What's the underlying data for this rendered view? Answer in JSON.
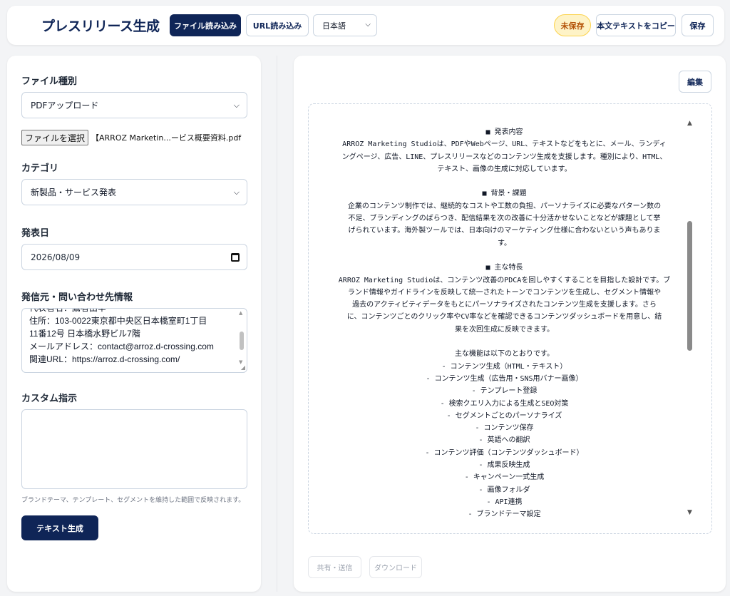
{
  "header": {
    "title": "プレスリリース生成",
    "file_import": "ファイル読み込み",
    "url_import": "URL読み込み",
    "language": "日本語",
    "unsaved": "未保存",
    "copy_text": "本文テキストをコピー",
    "save": "保存"
  },
  "form": {
    "file_type_label": "ファイル種別",
    "file_type_value": "PDFアップロード",
    "choose_file": "ファイルを選択",
    "file_name": "【ARROZ Marketin...ービス概要資料.pdf",
    "category_label": "カテゴリ",
    "category_value": "新製品・サービス発表",
    "date_label": "発表日",
    "date_value": "2026/08/09",
    "contact_label": "発信元・問い合わせ先情報",
    "contact_lines": [
      "代表者名：鷹者由幸",
      "住所：103-0022東京都中央区日本橋室町1丁目",
      "11番12号 日本橋水野ビル7階",
      "メールアドレス：contact@arroz.d-crossing.com",
      "関連URL：https://arroz.d-crossing.com/"
    ],
    "custom_label": "カスタム指示",
    "custom_value": "",
    "hint": "ブランドテーマ、テンプレート、セグメントを維持した範囲で反映されます。",
    "generate": "テキスト生成"
  },
  "preview": {
    "edit": "編集",
    "lines": [
      "■ 発表内容",
      "ARROZ Marketing Studioは、PDFやWebページ、URL、テキストなどをもとに、メール、ランディ",
      "ングページ、広告、LINE、プレスリリースなどのコンテンツ生成を支援します。種別により、HTML、",
      "テキスト、画像の生成に対応しています。",
      "",
      "■ 背景・課題",
      "企業のコンテンツ制作では、継続的なコストや工数の負担、パーソナライズに必要なパターン数の",
      "不足、ブランディングのばらつき、配信結果を次の改善に十分活かせないことなどが課題として挙",
      "げられています。海外製ツールでは、日本向けのマーケティング仕様に合わないという声もありま",
      "す。",
      "",
      "■ 主な特長",
      "ARROZ Marketing Studioは、コンテンツ改善のPDCAを回しやすくすることを目指した設計です。ブ",
      "ランド情報やガイドラインを反映して統一されたトーンでコンテンツを生成し、セグメント情報や",
      "過去のアクティビティデータをもとにパーソナライズされたコンテンツ生成を支援します。さら",
      "に、コンテンツごとのクリック率やCV率などを確認できるコンテンツダッシュボードを用意し、結",
      "果を次回生成に反映できます。",
      "",
      "主な機能は以下のとおりです。",
      "- コンテンツ生成（HTML・テキスト）",
      "- コンテンツ生成（広告用・SNS用バナー画像）",
      "- テンプレート登録",
      "- 検索クエリ入力による生成とSEO対策",
      "- セグメントごとのパーソナライズ",
      "- コンテンツ保存",
      "- 英語への翻訳",
      "- コンテンツ評価（コンテンツダッシュボード）",
      "- 成果反映生成",
      "- キャンペーン一式生成",
      "- 画像フォルダ",
      "- API連携",
      "- ブランドテーマ設定"
    ],
    "share": "共有・送信",
    "download": "ダウンロード"
  }
}
